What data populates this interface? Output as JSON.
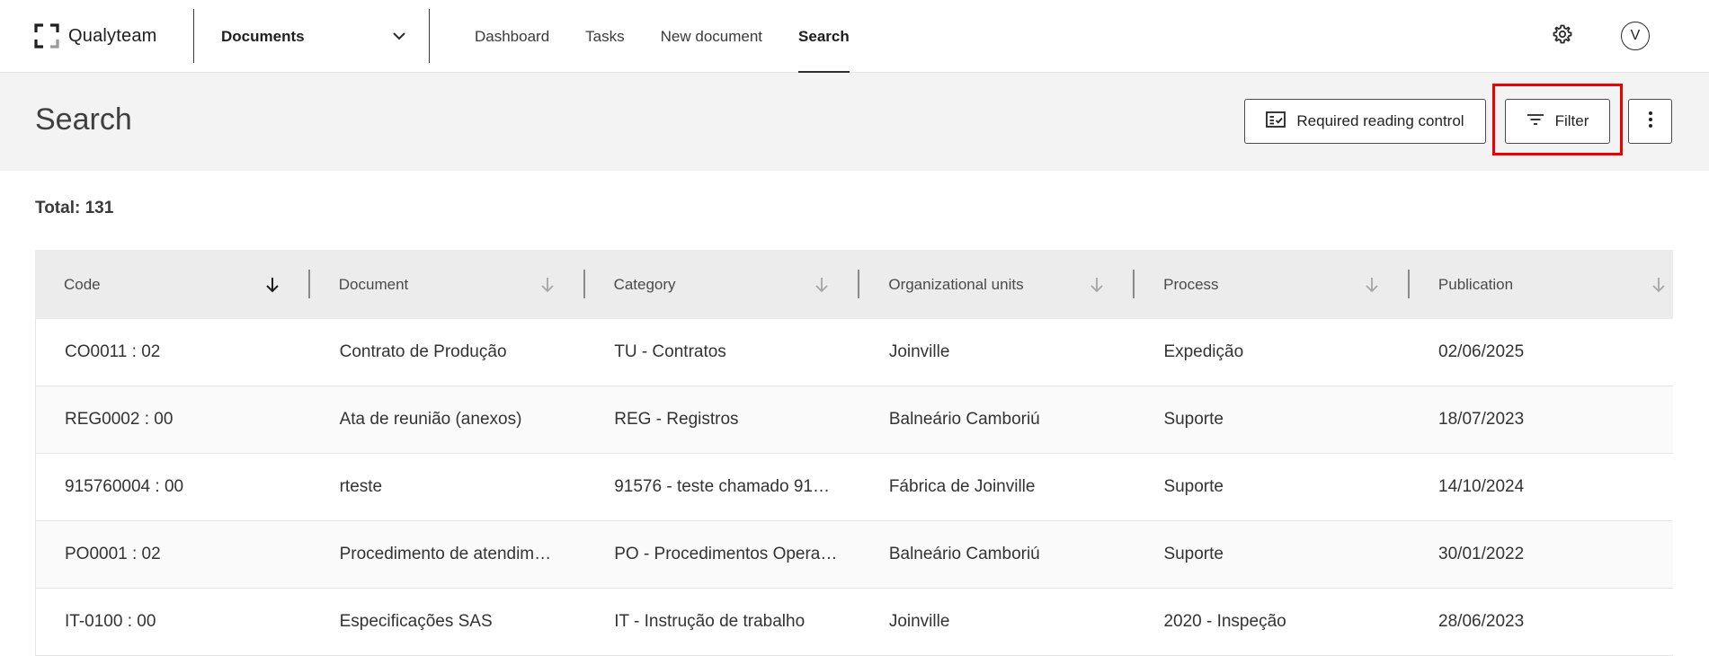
{
  "app": {
    "logo_text": "Qualyteam",
    "module": "Documents"
  },
  "nav": {
    "items": [
      {
        "label": "Dashboard",
        "active": false
      },
      {
        "label": "Tasks",
        "active": false
      },
      {
        "label": "New document",
        "active": false
      },
      {
        "label": "Search",
        "active": true
      }
    ]
  },
  "user": {
    "avatar_initial": "V"
  },
  "header": {
    "title": "Search",
    "required_reading_label": "Required reading control",
    "filter_label": "Filter"
  },
  "summary": {
    "total": "Total: 131"
  },
  "table": {
    "columns": [
      "Code",
      "Document",
      "Category",
      "Organizational units",
      "Process",
      "Publication"
    ],
    "rows": [
      [
        "CO0011 : 02",
        "Contrato de Produção",
        "TU - Contratos",
        "Joinville",
        "Expedição",
        "02/06/2025"
      ],
      [
        "REG0002 : 00",
        "Ata de reunião (anexos)",
        "REG - Registros",
        "Balneário Camboriú",
        "Suporte",
        "18/07/2023"
      ],
      [
        "915760004 : 00",
        "rteste",
        "91576 - teste chamado 91…",
        "Fábrica de Joinville",
        "Suporte",
        "14/10/2024"
      ],
      [
        "PO0001 : 02",
        "Procedimento de atendim…",
        "PO - Procedimentos Opera…",
        "Balneário Camboriú",
        "Suporte",
        "30/01/2022"
      ],
      [
        "IT-0100 : 00",
        "Especificações SAS",
        "IT - Instrução de trabalho",
        "Joinville",
        "2020 - Inspeção",
        "28/06/2023"
      ]
    ]
  },
  "colors": {
    "highlight": "#ee0000",
    "header_band": "#f3f3f3",
    "table_header": "#ececec"
  }
}
